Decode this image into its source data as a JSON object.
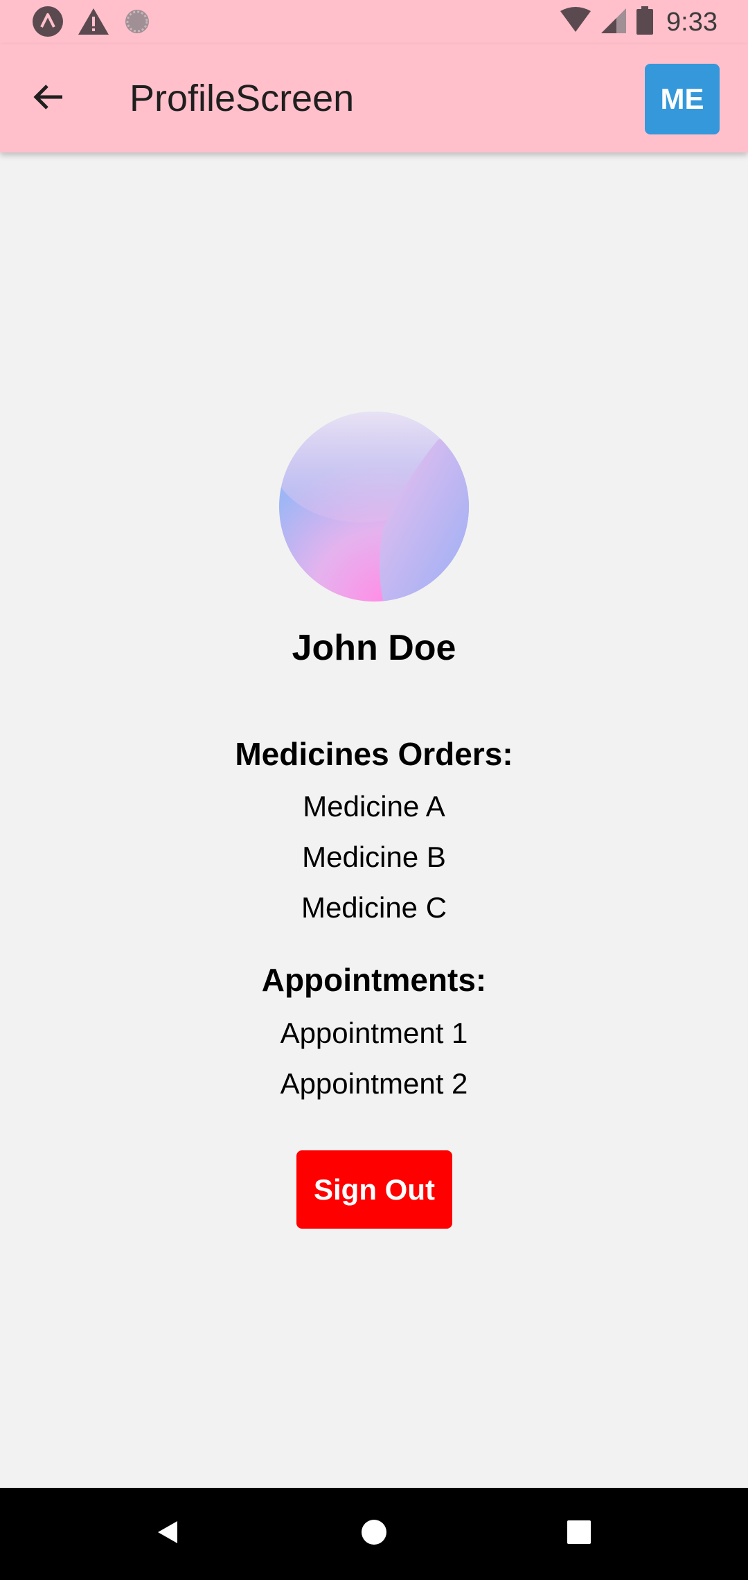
{
  "status_bar": {
    "time": "9:33",
    "left_icons": [
      "app-notification-icon",
      "warning-icon",
      "loading-icon"
    ],
    "right_icons": [
      "wifi-icon",
      "cell-signal-icon",
      "battery-icon"
    ]
  },
  "app_bar": {
    "title": "ProfileScreen",
    "back_icon": "arrow-back-icon",
    "me_label": "ME",
    "me_color": "#3498db",
    "background": "#ffc0cb"
  },
  "profile": {
    "name": "John Doe",
    "medicines_title": "Medicines Orders:",
    "medicines": [
      "Medicine A",
      "Medicine B",
      "Medicine C"
    ],
    "appointments_title": "Appointments:",
    "appointments": [
      "Appointment 1",
      "Appointment 2"
    ],
    "signout_label": "Sign Out",
    "signout_color": "#ff0000"
  },
  "nav_bar": {
    "icons": [
      "nav-back-icon",
      "nav-home-icon",
      "nav-recents-icon"
    ]
  }
}
